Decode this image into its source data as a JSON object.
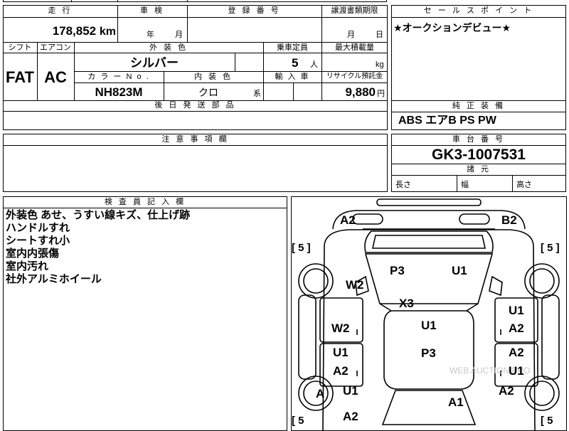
{
  "headers": {
    "mileage": "走 行",
    "inspection": "車 検",
    "registration_number": "登 録 番 号",
    "transfer_deadline": "譲渡書類期限",
    "sales_point": "セ ー ル ス ポ イ ン ト",
    "shift": "シフト",
    "aircon": "エアコン",
    "exterior_color": "外 装 色",
    "capacity": "乗車定員",
    "max_load": "最大積載量",
    "color_no": "カ ラ ー  N o .",
    "interior_color": "内 装 色",
    "import": "輸 入 車",
    "recycle": "リサイクル預託金",
    "later_parts": "後 日 発 送 部 品",
    "standard_equipment": "純 正 装 備",
    "notes": "注 意 事 項 欄",
    "chassis_number": "車 台 番 号",
    "dimensions": "諸 元",
    "inspector_notes": "検 査 員 記 入 欄"
  },
  "values": {
    "mileage": "178,852",
    "mileage_unit": "km",
    "year_suffix": "年",
    "month_suffix": "月",
    "transfer_month": "月",
    "transfer_day": "日",
    "shift": "FAT",
    "aircon": "AC",
    "exterior_color": "シルバー",
    "capacity": "5",
    "capacity_unit": "人",
    "load_unit": "kg",
    "color_no": "NH823M",
    "interior_color": "クロ",
    "interior_suffix": "系",
    "recycle_fee": "9,880",
    "recycle_unit": "円",
    "sales_point": "★オークションデビュー★",
    "standard_equipment": "ABS エアB PS PW",
    "chassis_number": "GK3-1007531",
    "length": "長さ",
    "width": "幅",
    "height": "高さ"
  },
  "remarks": [
    "外装色 あせ、うすい線キズ、仕上げ跡",
    "ハンドルすれ",
    "シートすれ小",
    "室内内張傷",
    "室内汚れ",
    "社外アルミホイール"
  ],
  "diagram": {
    "marks": {
      "a2_top_left": "A2",
      "b2_top_right": "B2",
      "tire_fl": "[ 5 ]",
      "tire_fr": "[ 5 ]",
      "tire_rl": "[ 5",
      "tire_rr": "[ 5",
      "w2_fender_left": "W2",
      "p3_windshield": "P3",
      "u1_windshield": "U1",
      "x3_hood": "X3",
      "u1_door_fr": "U1",
      "a2_door_fr": "A2",
      "w2_door_fl": "W2",
      "u1_roof": "U1",
      "p3_roof": "P3",
      "u1_door_rl": "U1",
      "a2_door_rl": "A2",
      "a2_door_rr": "A2",
      "u1_door_rr": "U1",
      "a_wheel_rl": "A",
      "u1_quarter_rl": "U1",
      "a2_quarter_rr": "A2",
      "a1_trunk": "A1",
      "a2_rear_left": "A2"
    },
    "watermark": "WEB AUCTION PRO"
  }
}
